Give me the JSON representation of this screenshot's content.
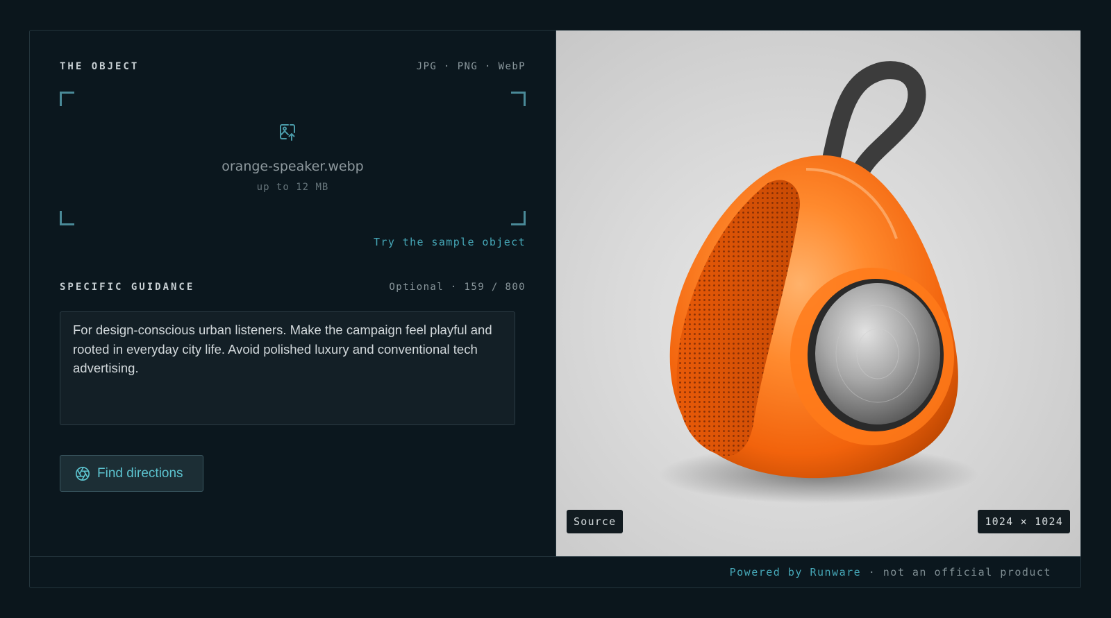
{
  "object_section": {
    "title": "THE OBJECT",
    "formats": "JPG · PNG · WebP",
    "file_name": "orange-speaker.webp",
    "file_hint": "up to 12 MB",
    "sample_link": "Try the sample object"
  },
  "guidance_section": {
    "title": "SPECIFIC GUIDANCE",
    "counter": "Optional · 159 / 800",
    "text": "For design-conscious urban listeners. Make the campaign feel playful and rooted in everyday city life. Avoid polished luxury and conventional tech advertising."
  },
  "action": {
    "find_label": "Find directions"
  },
  "preview": {
    "source_badge": "Source",
    "dimensions_badge": "1024 × 1024"
  },
  "footer": {
    "brand": "Powered by Runware",
    "disclaimer": " · not an official product"
  },
  "colors": {
    "background": "#0b161c",
    "accent": "#46a8b8",
    "speaker_orange": "#ff6a10"
  },
  "icons": {
    "upload": "image-upload-icon",
    "find": "aperture-icon"
  }
}
